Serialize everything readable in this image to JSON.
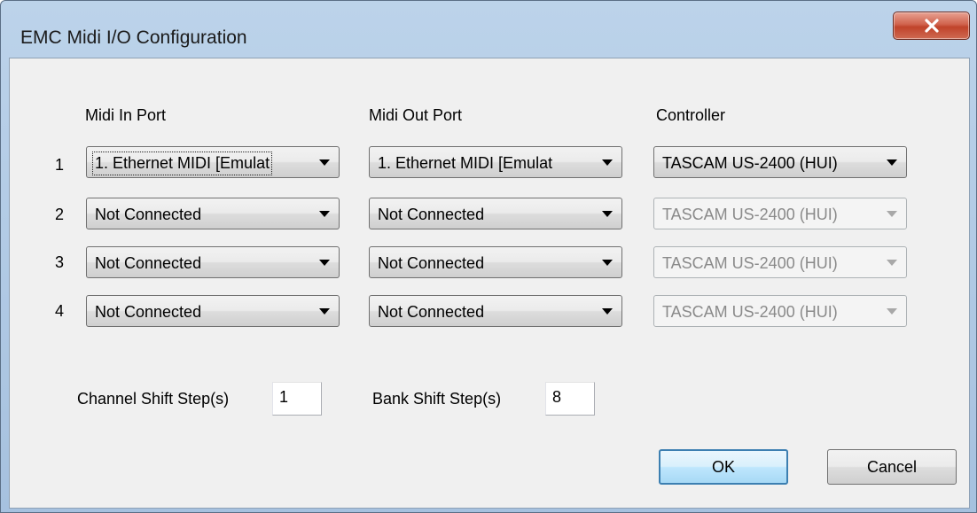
{
  "window": {
    "title": "EMC Midi I/O Configuration",
    "close_label": "x"
  },
  "headers": {
    "midi_in": "Midi In Port",
    "midi_out": "Midi Out Port",
    "controller": "Controller"
  },
  "rows": [
    {
      "number": "1",
      "midi_in": "1. Ethernet MIDI [Emulat",
      "midi_out": "1. Ethernet MIDI [Emulat",
      "controller": "TASCAM US-2400 (HUI)",
      "controller_enabled": true
    },
    {
      "number": "2",
      "midi_in": "Not Connected",
      "midi_out": "Not Connected",
      "controller": "TASCAM US-2400 (HUI)",
      "controller_enabled": false
    },
    {
      "number": "3",
      "midi_in": "Not Connected",
      "midi_out": "Not Connected",
      "controller": "TASCAM US-2400 (HUI)",
      "controller_enabled": false
    },
    {
      "number": "4",
      "midi_in": "Not Connected",
      "midi_out": "Not Connected",
      "controller": "TASCAM US-2400 (HUI)",
      "controller_enabled": false
    }
  ],
  "shift": {
    "channel_label": "Channel Shift Step(s)",
    "channel_value": "1",
    "bank_label": "Bank Shift Step(s)",
    "bank_value": "8"
  },
  "buttons": {
    "ok": "OK",
    "cancel": "Cancel"
  },
  "colors": {
    "title_bar": "#bcd3ea",
    "close_button": "#c0432a",
    "dialog_background": "#f0f0f0",
    "default_button_border": "#3c7fb1"
  }
}
